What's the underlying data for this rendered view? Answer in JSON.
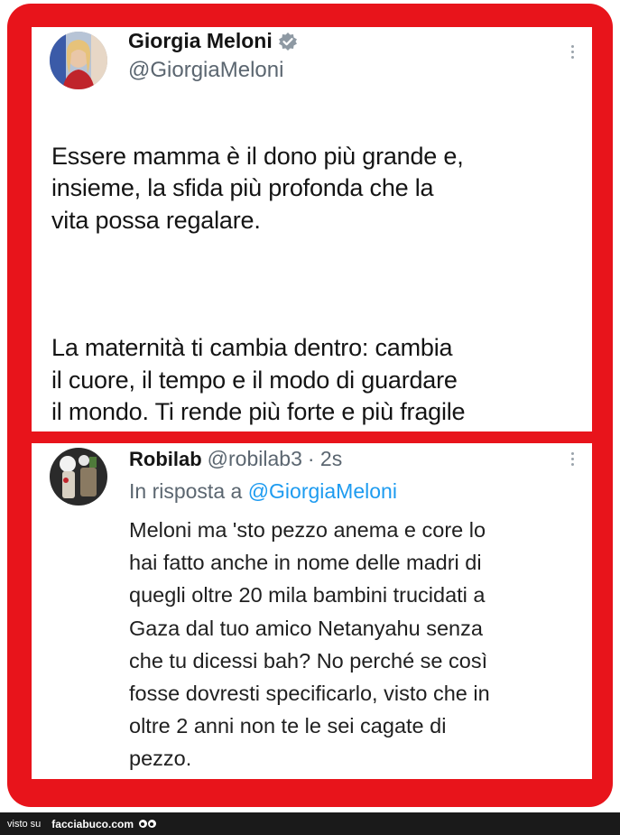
{
  "tweet": {
    "display_name": "Giorgia Meloni",
    "verified_icon": "verified-badge-icon",
    "handle": "@GiorgiaMeloni",
    "text_para1": "Essere mamma è il dono più grande e,\ninsieme, la sfida più profonda che la\nvita possa regalare.",
    "text_para2": "La maternità ti cambia dentro: cambia\nil cuore, il tempo e il modo di guardare\nil mondo. Ti rende più forte e più fragile\nallo stesso tempo. Ti insegna ogni\ngiorno cosa significhi amare davvero,"
  },
  "reply": {
    "display_name": "Robilab",
    "handle": "@robilab3",
    "time": "· 2s",
    "reply_prefix": "In risposta a",
    "reply_mention": "@GiorgiaMeloni",
    "text": "Meloni ma 'sto pezzo anema e core lo\nhai fatto anche in nome delle madri di\nquegli oltre 20 mila bambini trucidati a\nGaza dal tuo amico Netanyahu senza\nche tu dicessi bah? No perché se così\nfosse dovresti specificarlo, visto che in\noltre 2 anni non te le sei cagate di\npezzo."
  },
  "footer": {
    "visto_su": "visto su",
    "site": "facciabuco.com"
  },
  "colors": {
    "frame": "#e8141b",
    "mention": "#1d9bf0",
    "verified": "#8e99a3"
  }
}
